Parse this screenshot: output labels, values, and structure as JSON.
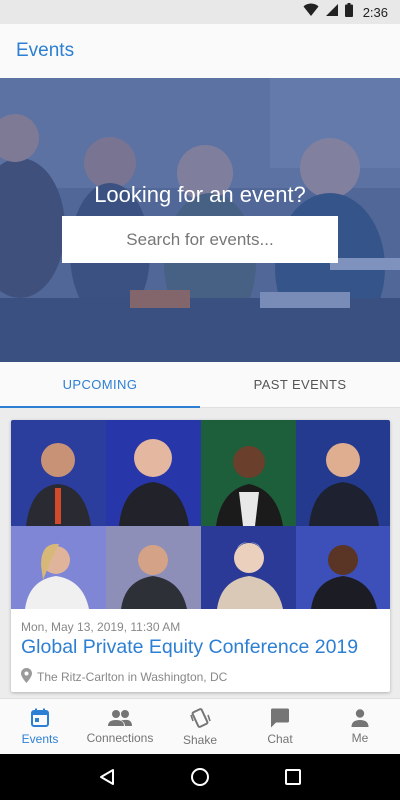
{
  "status_bar": {
    "time": "2:36",
    "icons": [
      "wifi-icon",
      "signal-icon",
      "battery-icon"
    ]
  },
  "app_bar": {
    "title": "Events"
  },
  "hero": {
    "heading": "Looking for an event?",
    "search_placeholder": "Search for events..."
  },
  "tabs": [
    {
      "label": "UPCOMING",
      "active": true
    },
    {
      "label": "PAST EVENTS",
      "active": false
    }
  ],
  "events": [
    {
      "date": "Mon, May 13, 2019, 11:30 AM",
      "title": "Global Private Equity Conference 2019",
      "venue": "The Ritz-Carlton in Washington, DC"
    }
  ],
  "bottom_nav": [
    {
      "label": "Events",
      "icon": "calendar-icon",
      "active": true
    },
    {
      "label": "Connections",
      "icon": "people-icon",
      "active": false
    },
    {
      "label": "Shake",
      "icon": "shake-phone-icon",
      "active": false
    },
    {
      "label": "Chat",
      "icon": "chat-bubble-icon",
      "active": false
    },
    {
      "label": "Me",
      "icon": "person-icon",
      "active": false
    }
  ],
  "colors": {
    "accent": "#2d7fd3",
    "hero_overlay": "#3756a0",
    "muted_text": "#888888"
  }
}
